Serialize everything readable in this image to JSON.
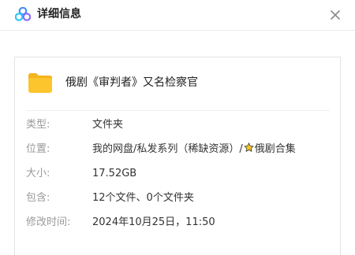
{
  "header": {
    "title": "详细信息",
    "logo_icon": "cloud-drive-logo-icon",
    "close_icon": "close-icon"
  },
  "file": {
    "icon": "folder-icon",
    "name": "俄剧《审判者》又名检察官"
  },
  "details": {
    "type_label": "类型:",
    "type_value": "文件夹",
    "location_label": "位置:",
    "location_path": "我的网盘/私发系列（稀缺资源）/",
    "location_star_icon": "star-icon",
    "location_tail": "俄剧合集",
    "size_label": "大小:",
    "size_value": "17.52GB",
    "contains_label": "包含:",
    "contains_value": "12个文件、0个文件夹",
    "modified_label": "修改时间:",
    "modified_value": "2024年10月25日，11:50"
  },
  "colors": {
    "label": "#9a9a9a",
    "value": "#333333",
    "folder": "#fcc52e",
    "star": "#f6c526"
  }
}
